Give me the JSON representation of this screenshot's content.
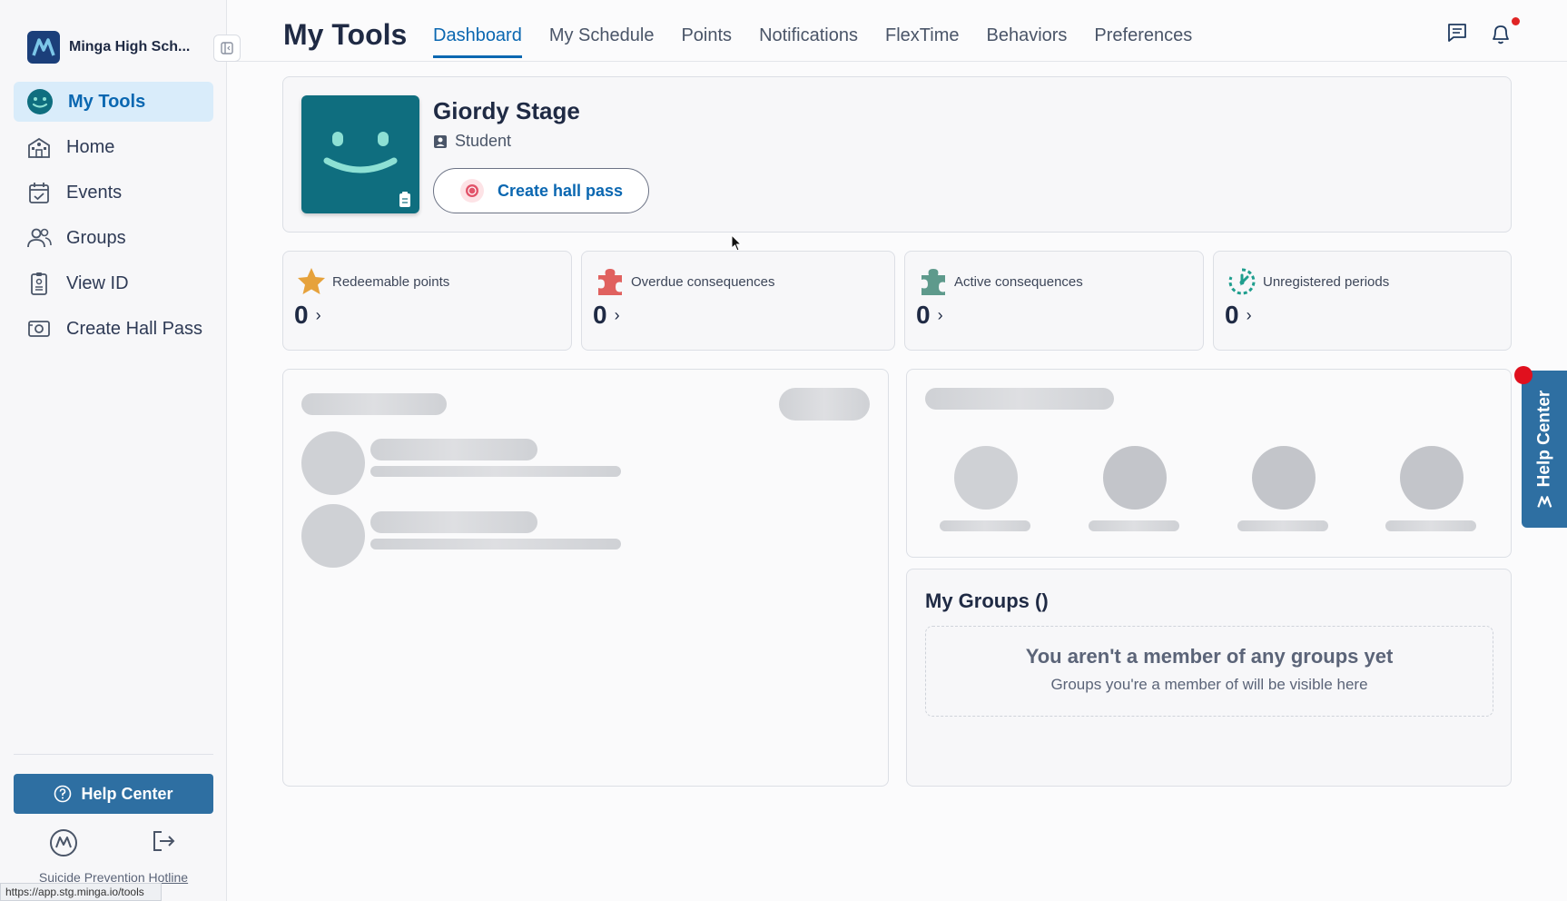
{
  "sidebar": {
    "org_name": "Minga High Sch...",
    "items": [
      {
        "label": "My Tools",
        "icon": "smile-icon",
        "active": true
      },
      {
        "label": "Home",
        "icon": "school-icon"
      },
      {
        "label": "Events",
        "icon": "calendar-icon"
      },
      {
        "label": "Groups",
        "icon": "people-icon"
      },
      {
        "label": "View ID",
        "icon": "id-card-icon"
      },
      {
        "label": "Create Hall Pass",
        "icon": "hall-pass-icon"
      }
    ],
    "help_label": "Help Center",
    "hotline_label": "Suicide Prevention Hotline",
    "status_url": "https://app.stg.minga.io/tools"
  },
  "header": {
    "title": "My Tools",
    "tabs": [
      {
        "label": "Dashboard",
        "active": true
      },
      {
        "label": "My Schedule"
      },
      {
        "label": "Points"
      },
      {
        "label": "Notifications"
      },
      {
        "label": "FlexTime"
      },
      {
        "label": "Behaviors"
      },
      {
        "label": "Preferences"
      }
    ]
  },
  "profile": {
    "name": "Giordy Stage",
    "role": "Student",
    "hall_pass_label": "Create hall pass"
  },
  "stats": [
    {
      "label": "Redeemable points",
      "value": "0",
      "icon": "star-icon",
      "color": "#e6a23c"
    },
    {
      "label": "Overdue consequences",
      "value": "0",
      "icon": "puzzle-icon",
      "color": "#e0615f"
    },
    {
      "label": "Active consequences",
      "value": "0",
      "icon": "puzzle-icon",
      "color": "#5e9a8c"
    },
    {
      "label": "Unregistered periods",
      "value": "0",
      "icon": "timer-icon",
      "color": "#1f9e8e"
    }
  ],
  "groups": {
    "title": "My Groups ()",
    "empty_title": "You aren't a member of any groups yet",
    "empty_sub": "Groups you're a member of will be visible here"
  },
  "help_tab_label": "Help Center"
}
